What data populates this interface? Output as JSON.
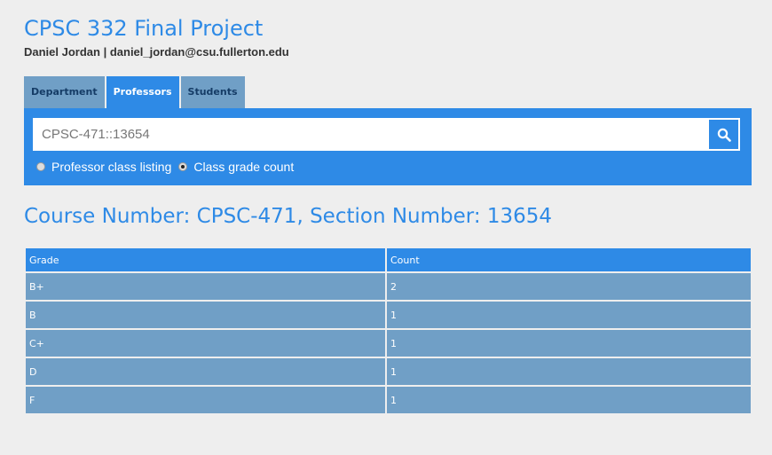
{
  "header": {
    "title": "CPSC 332 Final Project",
    "author": "Daniel Jordan | daniel_jordan@csu.fullerton.edu"
  },
  "tabs": [
    {
      "label": "Department",
      "active": false
    },
    {
      "label": "Professors",
      "active": true
    },
    {
      "label": "Students",
      "active": false
    }
  ],
  "search": {
    "value": "CPSC-471::13654",
    "icon": "search-icon"
  },
  "options": [
    {
      "label": "Professor class listing",
      "checked": false
    },
    {
      "label": "Class grade count",
      "checked": true
    }
  ],
  "result": {
    "heading": "Course Number: CPSC-471, Section Number: 13654"
  },
  "table": {
    "headers": [
      "Grade",
      "Count"
    ],
    "rows": [
      [
        "B+",
        "2"
      ],
      [
        "B",
        "1"
      ],
      [
        "C+",
        "1"
      ],
      [
        "D",
        "1"
      ],
      [
        "F",
        "1"
      ]
    ]
  },
  "colors": {
    "accent": "#2e8ae6",
    "row_bg": "#709fc6",
    "page_bg": "#eeeeee"
  }
}
